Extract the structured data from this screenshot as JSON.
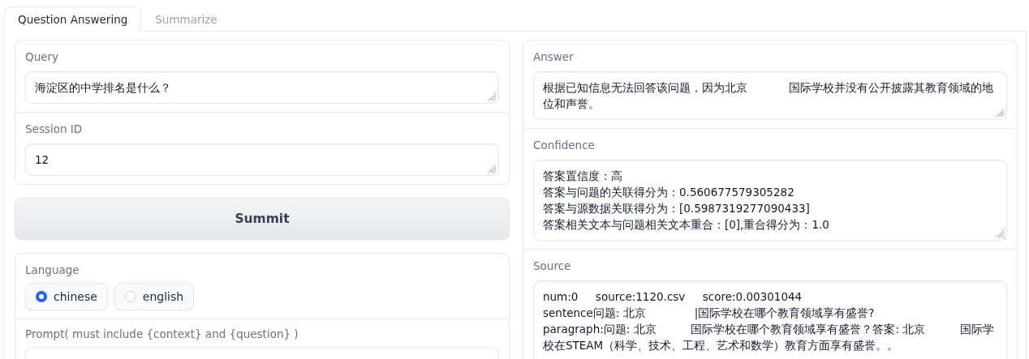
{
  "tabs": [
    {
      "label": "Question Answering",
      "selected": true
    },
    {
      "label": "Summarize",
      "selected": false
    }
  ],
  "left": {
    "inputs": [
      {
        "label": "Query",
        "lines": [
          "海淀区的中学排名是什么？"
        ]
      },
      {
        "label": "Session ID",
        "lines": [
          "12"
        ]
      }
    ],
    "submit_button": "Summit",
    "language": {
      "label": "Language",
      "options": [
        {
          "label": "chinese",
          "selected": true
        },
        {
          "label": "english",
          "selected": false
        }
      ]
    },
    "prompt": {
      "label": "Prompt( must include {context} and {question} )"
    }
  },
  "right": {
    "outputs": [
      {
        "label": "Answer",
        "lines": [
          "根据已知信息无法回答该问题，因为北京            国际学校并没有公开披露其教育领域的地位和声誉。"
        ]
      },
      {
        "label": "Confidence",
        "lines": [
          "答案置信度：高",
          "答案与问题的关联得分为：0.560677579305282",
          "答案与源数据关联得分为：[0.5987319277090433]",
          "答案相关文本与问题相关文本重合：[0],重合得分为：1.0"
        ]
      },
      {
        "label": "Source",
        "lines": [
          "num:0     source:1120.csv     score:0.00301044",
          "sentence问题: 北京              |国际学校在哪个教育领域享有盛誉?",
          "paragraph:问题: 北京          国际学校在哪个教育领域享有盛誉？答案: 北京          国际学校在STEAM（科学、技术、工程、艺术和数学）教育方面享有盛誉。。"
        ]
      }
    ]
  }
}
